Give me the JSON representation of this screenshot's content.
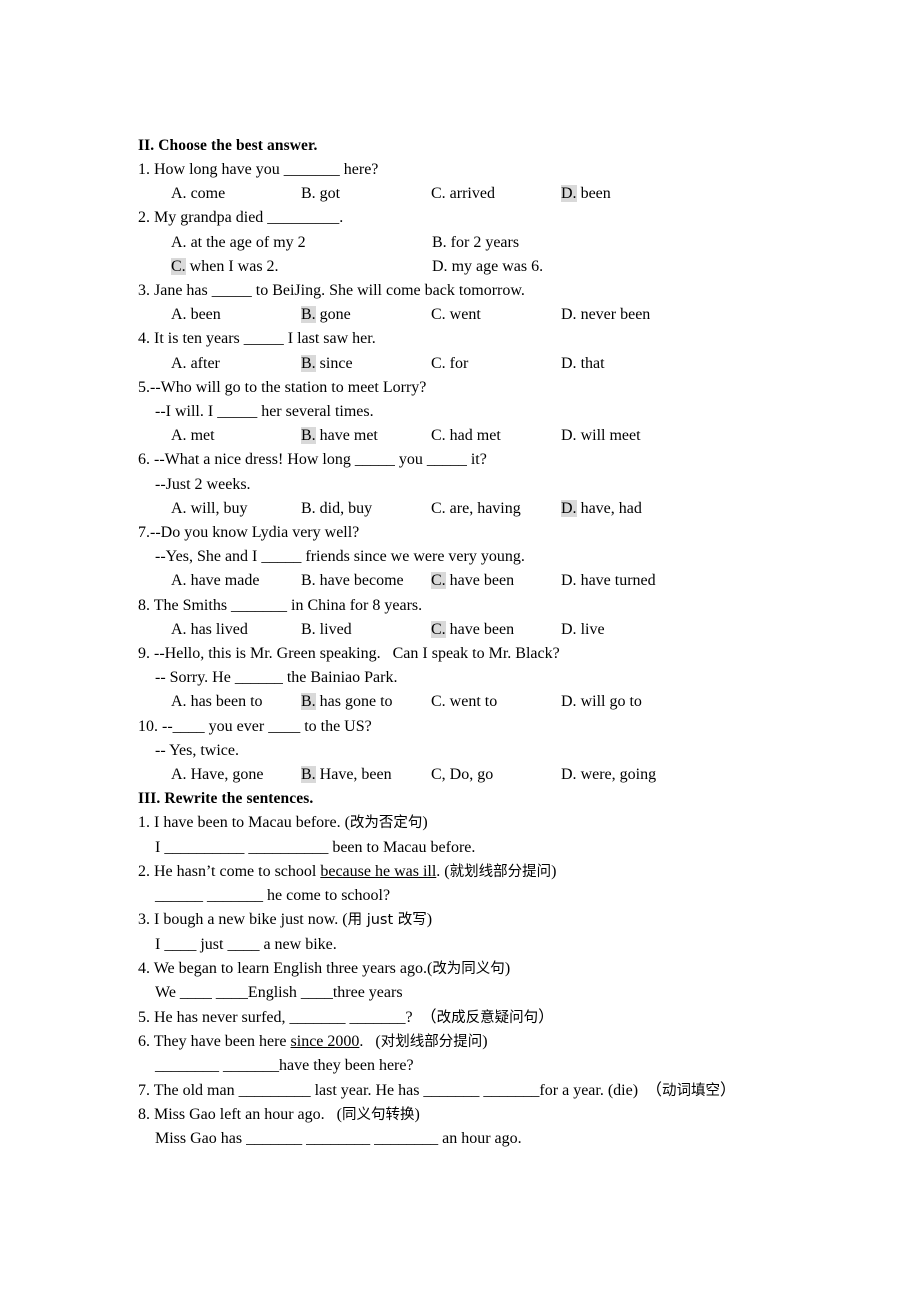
{
  "document": {
    "sections": [
      {
        "id": "section-2",
        "heading": "II. Choose the best answer.",
        "questions": [
          {
            "stem": "1. How long have you _______ here?",
            "layout": "four",
            "options": [
              {
                "tag": "A.",
                "text": " come",
                "selected": false
              },
              {
                "tag": "B.",
                "text": " got",
                "selected": false
              },
              {
                "tag": "C.",
                "text": " arrived",
                "selected": false
              },
              {
                "tag": "D.",
                "text": " been",
                "selected": true
              }
            ]
          },
          {
            "stem": "2. My grandpa died _________.",
            "layout": "two",
            "options": [
              {
                "tag": "A.",
                "text": " at the age of my 2",
                "selected": false
              },
              {
                "tag": "B.",
                "text": " for 2 years",
                "selected": false
              },
              {
                "tag": "C.",
                "text": " when I was 2.",
                "selected": true
              },
              {
                "tag": "D.",
                "text": " my age was 6.",
                "selected": false
              }
            ]
          },
          {
            "stem": "3. Jane has _____ to BeiJing. She will come back tomorrow.",
            "layout": "four",
            "options": [
              {
                "tag": "A.",
                "text": " been",
                "selected": false
              },
              {
                "tag": "B.",
                "text": " gone",
                "selected": true
              },
              {
                "tag": "C.",
                "text": " went",
                "selected": false
              },
              {
                "tag": "D.",
                "text": " never been",
                "selected": false
              }
            ]
          },
          {
            "stem": "4. It is ten years _____ I last saw her.",
            "layout": "four",
            "options": [
              {
                "tag": "A.",
                "text": " after",
                "selected": false
              },
              {
                "tag": "B.",
                "text": " since",
                "selected": true
              },
              {
                "tag": "C.",
                "text": " for",
                "selected": false
              },
              {
                "tag": "D.",
                "text": " that",
                "selected": false
              }
            ]
          },
          {
            "stem": "5.--Who will go to the station to meet Lorry?",
            "sub": "--I will. I _____ her several times.",
            "layout": "four",
            "options": [
              {
                "tag": "A.",
                "text": " met",
                "selected": false
              },
              {
                "tag": "B.",
                "text": " have met",
                "selected": true
              },
              {
                "tag": "C.",
                "text": " had met",
                "selected": false
              },
              {
                "tag": "D.",
                "text": " will meet",
                "selected": false
              }
            ]
          },
          {
            "stem": "6. --What a nice dress! How long _____ you _____ it?",
            "sub": "--Just 2 weeks.",
            "layout": "four",
            "options": [
              {
                "tag": "A.",
                "text": " will, buy",
                "selected": false
              },
              {
                "tag": "B.",
                "text": " did, buy",
                "selected": false
              },
              {
                "tag": "C.",
                "text": " are, having",
                "selected": false
              },
              {
                "tag": "D.",
                "text": " have, had",
                "selected": true
              }
            ]
          },
          {
            "stem": "7.--Do you know Lydia very well?",
            "sub": "--Yes, She and I _____ friends since we were very young.",
            "layout": "four",
            "options": [
              {
                "tag": "A.",
                "text": " have made",
                "selected": false
              },
              {
                "tag": "B.",
                "text": " have become",
                "selected": false
              },
              {
                "tag": "C.",
                "text": " have been",
                "selected": true
              },
              {
                "tag": "D.",
                "text": " have turned",
                "selected": false
              }
            ]
          },
          {
            "stem": "8. The Smiths _______ in China for 8 years.",
            "layout": "four",
            "options": [
              {
                "tag": "A.",
                "text": " has lived",
                "selected": false
              },
              {
                "tag": "B.",
                "text": " lived",
                "selected": false
              },
              {
                "tag": "C.",
                "text": " have been",
                "selected": true
              },
              {
                "tag": "D.",
                "text": " live",
                "selected": false
              }
            ]
          },
          {
            "stem": "9. --Hello, this is Mr. Green speaking.   Can I speak to Mr. Black?",
            "sub": "-- Sorry. He ______ the Bainiao Park.",
            "layout": "four",
            "options": [
              {
                "tag": "A.",
                "text": " has been to",
                "selected": false
              },
              {
                "tag": "B.",
                "text": " has gone to",
                "selected": true
              },
              {
                "tag": "C.",
                "text": " went to",
                "selected": false
              },
              {
                "tag": "D.",
                "text": " will go to",
                "selected": false
              }
            ]
          },
          {
            "stem": "10. --____ you ever ____ to the US?",
            "sub": "-- Yes, twice.",
            "layout": "four",
            "options": [
              {
                "tag": "A.",
                "text": " Have, gone",
                "selected": false
              },
              {
                "tag": "B.",
                "text": " Have, been",
                "selected": true
              },
              {
                "tag": "C,",
                "text": " Do, go",
                "selected": false
              },
              {
                "tag": "D.",
                "text": " were, going",
                "selected": false
              }
            ]
          }
        ]
      },
      {
        "id": "section-3",
        "heading": "III. Rewrite the sentences.",
        "items": [
          {
            "prompt_pre": "1. I have been to Macau before. (",
            "prompt_zh": "改为否定句",
            "prompt_post": ")",
            "underlined": "",
            "answer": "I __________ __________ been to Macau before."
          },
          {
            "prompt_pre": "2. He hasn’t come to school ",
            "prompt_underline": "because he was ill",
            "prompt_mid": ". (",
            "prompt_zh": "就划线部分提问",
            "prompt_post": ")",
            "answer": "______ _______ he come to school?"
          },
          {
            "prompt_pre": "3. I bough a new bike just now. (",
            "prompt_zh": "用 just 改写",
            "prompt_post": ")",
            "answer": "I ____ just ____ a new bike."
          },
          {
            "prompt_pre": "4. We began to learn English three years ago.(",
            "prompt_zh": "改为同义句",
            "prompt_post": ")",
            "answer": "We ____ ____English ____three years"
          },
          {
            "prompt_pre": "5. He has never surfed, _______ _______?  （",
            "prompt_zh": "改成反意疑问句",
            "prompt_post": "）",
            "answer": ""
          },
          {
            "prompt_pre": "6. They have been here ",
            "prompt_underline": "since 2000",
            "prompt_mid": ".   (",
            "prompt_zh": "对划线部分提问",
            "prompt_post": ")",
            "answer": "________ _______have they been here?"
          },
          {
            "prompt_pre": "7. The old man _________ last year. He has _______ _______for a year. (die)  （",
            "prompt_zh": "动词填空",
            "prompt_post": "）",
            "answer": ""
          },
          {
            "prompt_pre": "8. Miss Gao left an hour ago.   (",
            "prompt_zh": "同义句转换",
            "prompt_post": ")",
            "answer": "Miss Gao has _______ ________ ________ an hour ago."
          }
        ]
      }
    ]
  },
  "style": {
    "highlight_color": "#d9d9d9",
    "text_color": "#000000",
    "page_background": "#ffffff"
  }
}
